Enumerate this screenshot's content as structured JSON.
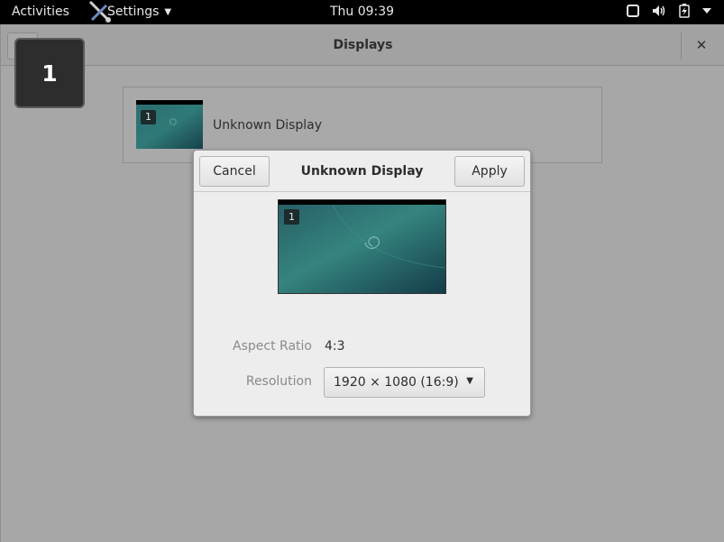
{
  "topbar": {
    "activities": "Activities",
    "app_menu": "Settings",
    "clock": "Thu 09:39",
    "status_icons": [
      "window-icon",
      "volume-icon",
      "battery-icon",
      "system-menu-arrow-icon"
    ]
  },
  "window": {
    "title": "Displays",
    "display_row": {
      "number": "1",
      "label": "Unknown Display"
    }
  },
  "identify": {
    "number": "1"
  },
  "dialog": {
    "title": "Unknown Display",
    "cancel_label": "Cancel",
    "apply_label": "Apply",
    "preview_number": "1",
    "aspect_ratio_label": "Aspect Ratio",
    "aspect_ratio_value": "4:3",
    "resolution_label": "Resolution",
    "resolution_value": "1920 × 1080 (16:9)"
  },
  "colors": {
    "topbar_bg": "#000000",
    "window_dimmed_bg": "#a7a7a7",
    "dialog_bg": "#ededed",
    "wallpaper_teal": "#2a6b6e"
  }
}
